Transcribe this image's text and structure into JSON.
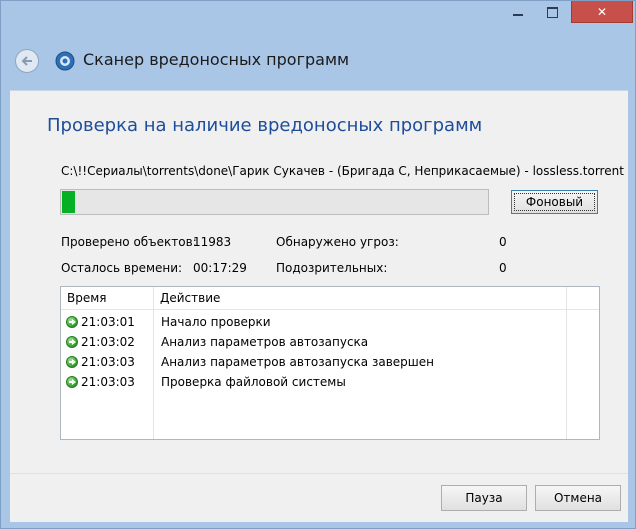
{
  "window": {
    "title": "Сканер вредоносных программ",
    "close_glyph": "✕"
  },
  "page": {
    "heading": "Проверка на наличие вредоносных программ",
    "current_path": "C:\\!!Сериалы\\torrents\\done\\Гарик Сукачев - (Бригада С, Неприкасаемые) - lossless.torrent"
  },
  "progress": {
    "percent": 3
  },
  "buttons": {
    "background": "Фоновый",
    "pause": "Пауза",
    "cancel": "Отмена"
  },
  "stats": {
    "checked_label": "Проверено объектов:",
    "checked_value": "11983",
    "remaining_label": "Осталось времени:",
    "remaining_value": "00:17:29",
    "threats_label": "Обнаружено угроз:",
    "threats_value": "0",
    "suspicious_label": "Подозрительных:",
    "suspicious_value": "0"
  },
  "log": {
    "columns": [
      "Время",
      "Действие"
    ],
    "rows": [
      {
        "time": "21:03:01",
        "action": "Начало проверки",
        "icon": "green-arrow-icon"
      },
      {
        "time": "21:03:02",
        "action": "Анализ параметров автозапуска",
        "icon": "green-arrow-icon"
      },
      {
        "time": "21:03:03",
        "action": "Анализ параметров автозапуска завершен",
        "icon": "green-arrow-icon"
      },
      {
        "time": "21:03:03",
        "action": "Проверка файловой системы",
        "icon": "green-arrow-icon"
      }
    ]
  },
  "colors": {
    "accent_heading": "#1e4d9a",
    "progress_fill": "#06b025",
    "close_button": "#c7504a"
  }
}
